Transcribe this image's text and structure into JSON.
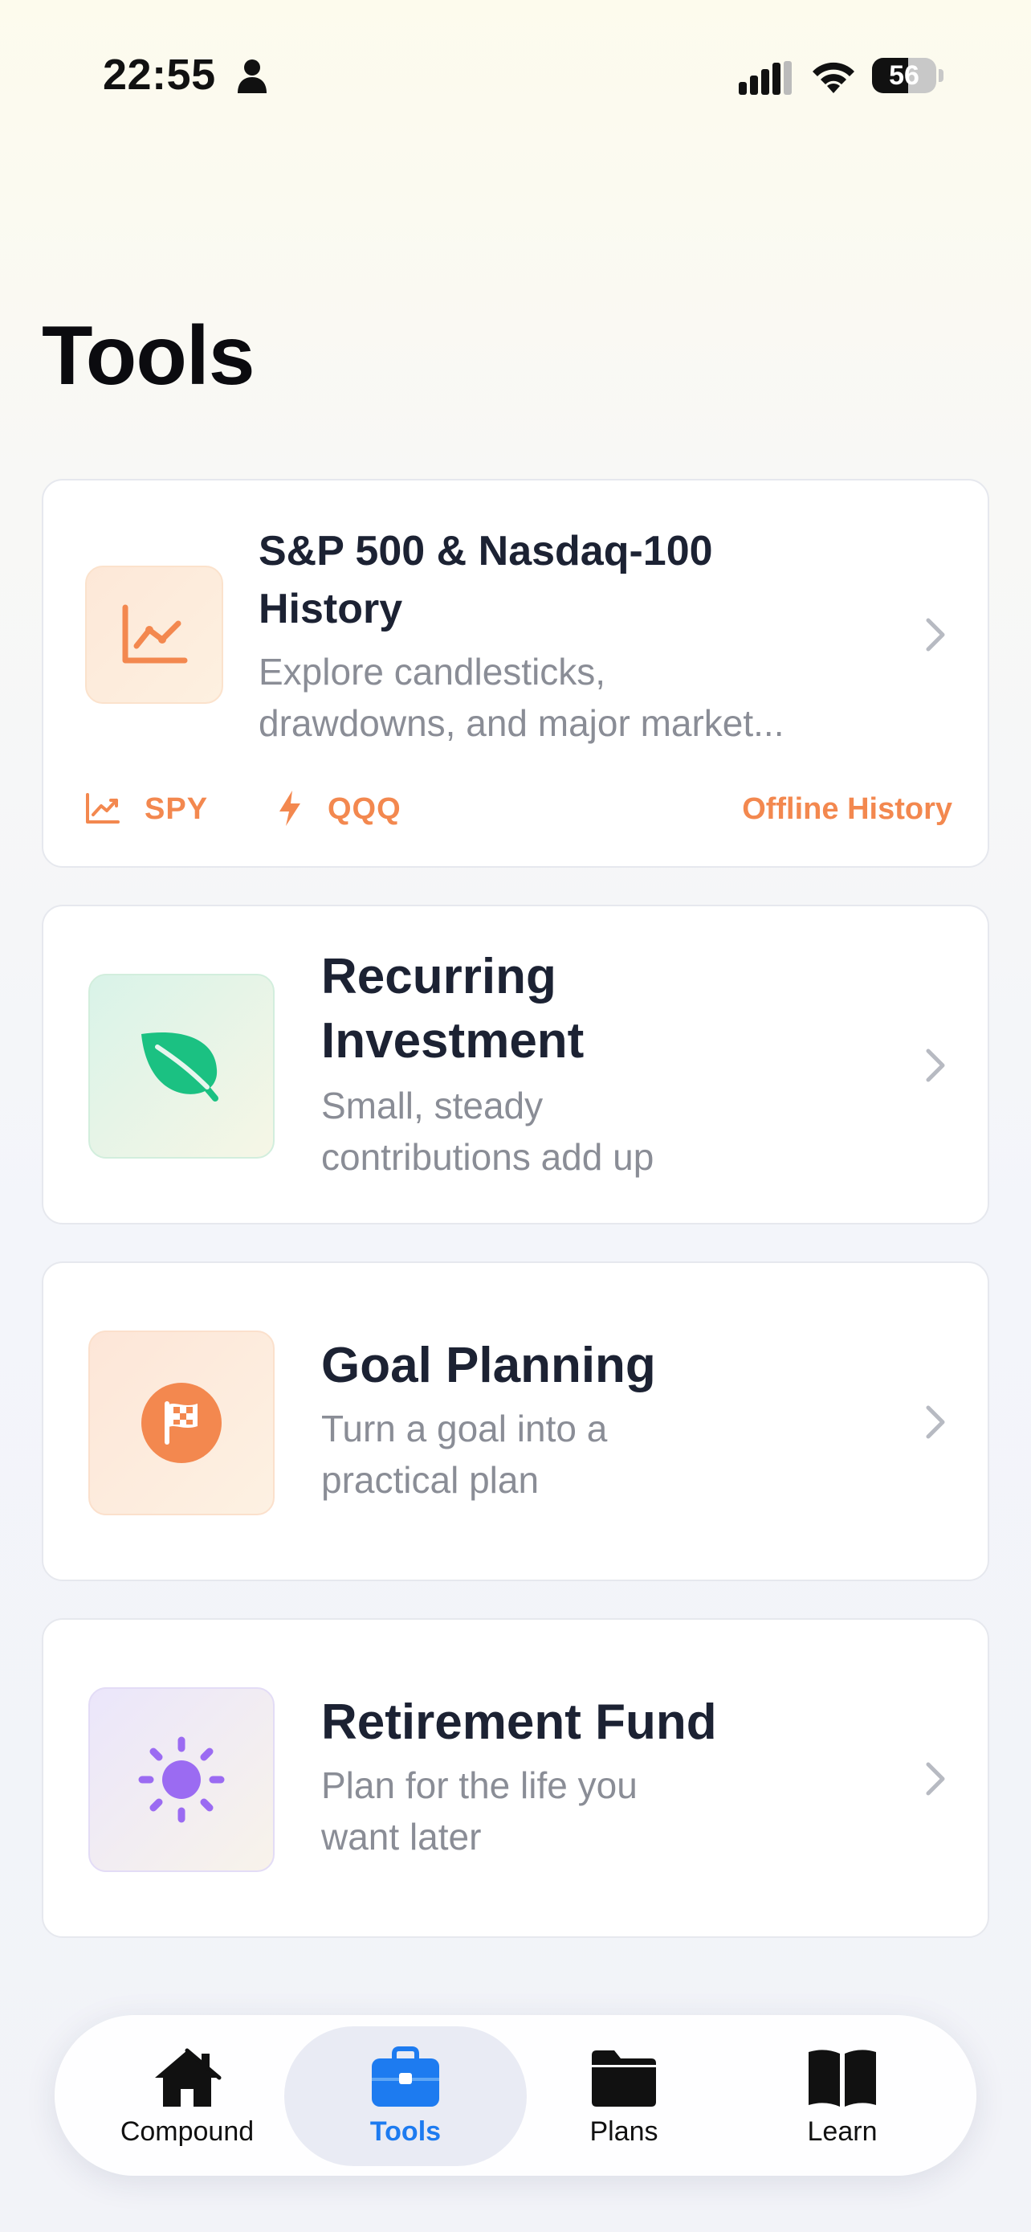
{
  "status_bar": {
    "time": "22:55",
    "battery": "56",
    "battery_level": 0.56
  },
  "page": {
    "title": "Tools"
  },
  "cards": [
    {
      "title_lines": [
        "S&P 500 & Nasdaq-100",
        "History"
      ],
      "desc_lines": [
        "Explore candlesticks,",
        "drawdowns, and major market..."
      ],
      "tags": [
        "SPY",
        "QQQ"
      ],
      "badge": "Offline History",
      "icon": "line-chart-icon"
    },
    {
      "title_lines": [
        "Recurring",
        "Investment"
      ],
      "desc_lines": [
        "Small, steady",
        "contributions add up"
      ],
      "icon": "leaf-icon"
    },
    {
      "title_lines": [
        "Goal Planning"
      ],
      "desc_lines": [
        "Turn a goal into a",
        "practical plan"
      ],
      "icon": "checkered-flag-icon"
    },
    {
      "title_lines": [
        "Retirement Fund"
      ],
      "desc_lines": [
        "Plan for the life you",
        "want later"
      ],
      "icon": "sun-icon"
    }
  ],
  "tabbar": {
    "active": "Tools",
    "tabs": [
      {
        "label": "Compound",
        "icon": "house-icon"
      },
      {
        "label": "Tools",
        "icon": "briefcase-icon"
      },
      {
        "label": "Plans",
        "icon": "folder-icon"
      },
      {
        "label": "Learn",
        "icon": "book-icon"
      }
    ]
  },
  "colors": {
    "accent_orange": "#f3884f",
    "accent_green": "#1bc182",
    "accent_purple": "#9b6bf2",
    "active_tab": "#1d7bf0",
    "title": "#1c2233",
    "subtitle": "#8a8d96"
  }
}
